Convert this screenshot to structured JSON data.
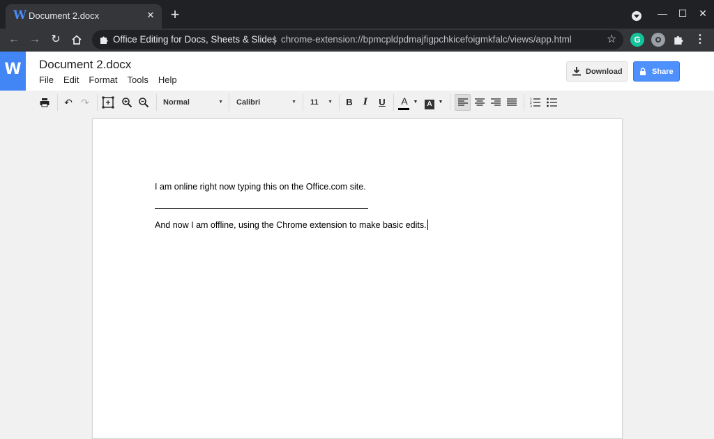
{
  "browser": {
    "tab": {
      "favicon_letter": "W",
      "title": "Document 2.docx"
    },
    "omnibox": {
      "site_name": "Office Editing for Docs, Sheets & Slides",
      "separator": "|",
      "url": "chrome-extension://bpmcpldpdmajfigpchkicefoigmkfalc/views/app.html"
    },
    "extensions": {
      "grammarly_letter": "G"
    }
  },
  "app": {
    "logo_letter": "W",
    "doc_title": "Document 2.docx",
    "menu": [
      "File",
      "Edit",
      "Format",
      "Tools",
      "Help"
    ],
    "download_label": "Download",
    "share_label": "Share"
  },
  "format_toolbar": {
    "style": "Normal",
    "font": "Calibri",
    "size": "11",
    "bold_glyph": "B",
    "italic_glyph": "I",
    "underline_glyph": "U",
    "font_color_glyph": "A",
    "highlight_glyph": "A"
  },
  "document": {
    "paragraph_1": "I am online right now typing this on the Office.com site.",
    "paragraph_2": "And now I am offline, using the Chrome extension to make basic edits."
  },
  "colors": {
    "accent": "#4285f4",
    "share_button": "#4d90fe",
    "chrome_dark": "#202124",
    "chrome_toolbar": "#35363a",
    "grammarly": "#15c39a"
  }
}
